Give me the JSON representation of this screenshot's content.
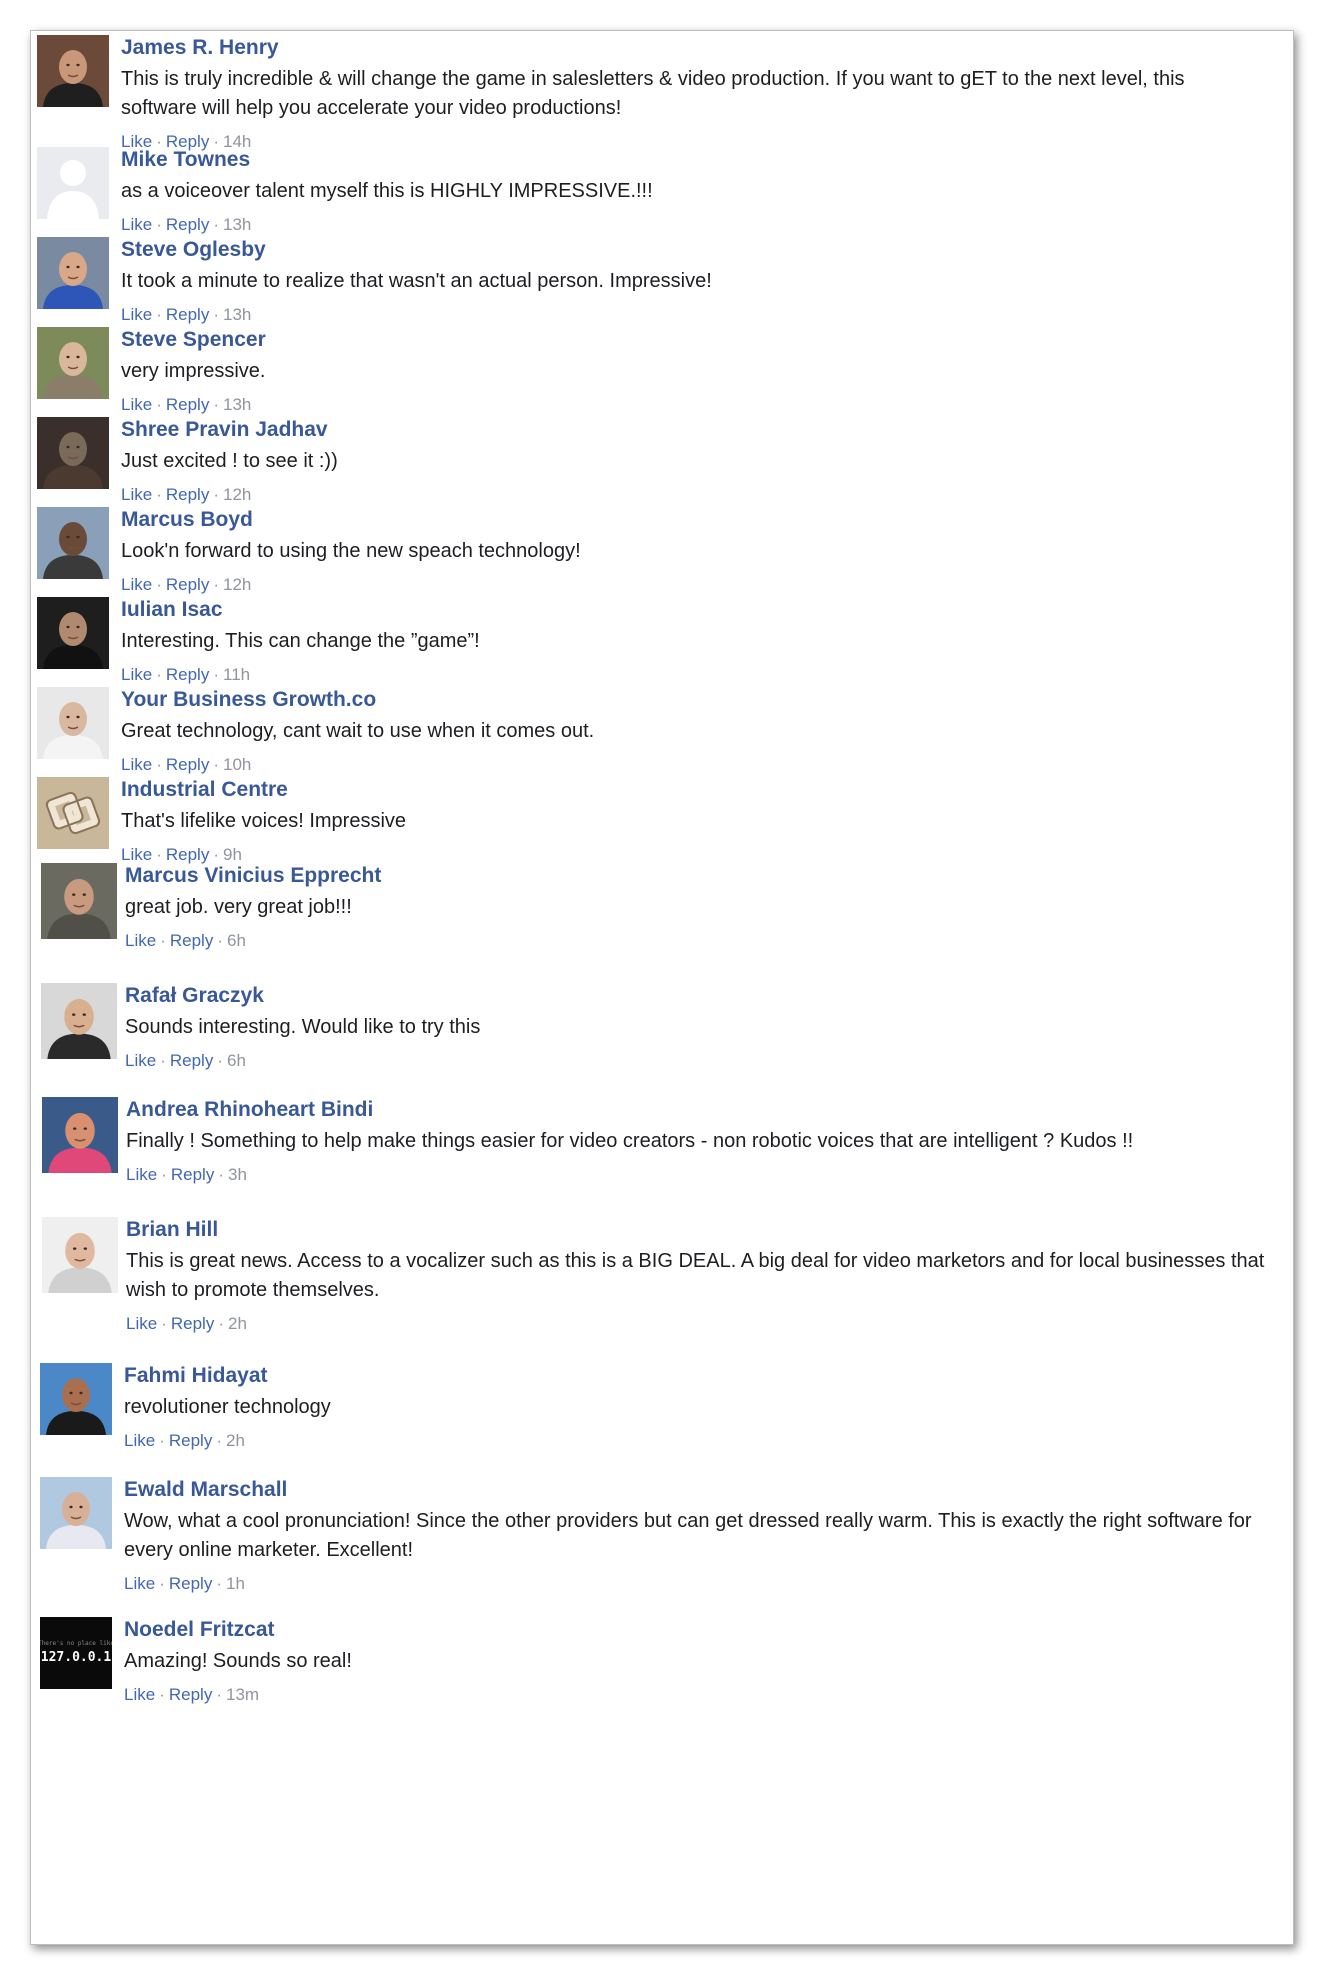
{
  "comments": [
    {
      "author": "James R. Henry",
      "text": "This is truly incredible & will change the game in salesletters & video production. If you want to gET to the next level, this software will help you accelerate your video productions!",
      "like": "Like",
      "reply": "Reply",
      "time": "14h",
      "avatar": {
        "icon": "portrait-man-dark-jacket",
        "bg": "#6b4a3a",
        "face": "#c89878",
        "shirt": "#1f1f1f"
      }
    },
    {
      "author": "Mike Townes",
      "text": "as a voiceover talent myself this is HIGHLY IMPRESSIVE.!!!",
      "like": "Like",
      "reply": "Reply",
      "time": "13h",
      "avatar": {
        "icon": "default-silhouette",
        "bg": "#e9ebee",
        "face": "#ffffff",
        "shirt": "#ffffff"
      }
    },
    {
      "author": "Steve Oglesby",
      "text": "It took a minute to realize that wasn't an actual person. Impressive!",
      "like": "Like",
      "reply": "Reply",
      "time": "13h",
      "avatar": {
        "icon": "portrait-man-blue-shirt",
        "bg": "#7a8aa0",
        "face": "#d8a888",
        "shirt": "#2d56b8"
      }
    },
    {
      "author": "Steve Spencer",
      "text": "very impressive.",
      "like": "Like",
      "reply": "Reply",
      "time": "13h",
      "avatar": {
        "icon": "portrait-man-outdoors",
        "bg": "#7d8a5a",
        "face": "#d9b79a",
        "shirt": "#8a7d6a"
      }
    },
    {
      "author": "Shree Pravin Jadhav",
      "text": "Just excited ! to see it :))",
      "like": "Like",
      "reply": "Reply",
      "time": "12h",
      "avatar": {
        "icon": "portrait-armored-character",
        "bg": "#3a2f2a",
        "face": "#7a6a5a",
        "shirt": "#4a3a30"
      }
    },
    {
      "author": "Marcus Boyd",
      "text": "Look'n forward to using the new speach technology!",
      "like": "Like",
      "reply": "Reply",
      "time": "12h",
      "avatar": {
        "icon": "portrait-man-sea-background",
        "bg": "#8aa0b8",
        "face": "#6a4a38",
        "shirt": "#3a3a3a"
      }
    },
    {
      "author": "Iulian Isac",
      "text": "Interesting. This can change the ”game”!",
      "like": "Like",
      "reply": "Reply",
      "time": "11h",
      "avatar": {
        "icon": "portrait-man-dark-badge",
        "bg": "#1e1e1e",
        "face": "#b08a70",
        "shirt": "#111111"
      }
    },
    {
      "author": "Your Business Growth.co",
      "text": "Great technology, cant wait to use when it comes out.",
      "like": "Like",
      "reply": "Reply",
      "time": "10h",
      "avatar": {
        "icon": "portrait-man-suit-red-tie",
        "bg": "#e8e8e8",
        "face": "#d8b8a0",
        "shirt": "#f4f4f4"
      }
    },
    {
      "author": "Industrial Centre",
      "text": "That's lifelike voices! Impressive",
      "like": "Like",
      "reply": "Reply",
      "time": "9h",
      "avatar": {
        "icon": "logo-knot",
        "bg": "#c9b79a",
        "face": "#efe6d6",
        "shirt": "#8a7458"
      }
    },
    {
      "author": "Marcus Vinicius Epprecht",
      "text": "great job. very great job!!!",
      "like": "Like",
      "reply": "Reply",
      "time": "6h",
      "avatar": {
        "icon": "portrait-man-grey-hair",
        "bg": "#6a6a60",
        "face": "#c89a80",
        "shirt": "#505048"
      }
    },
    {
      "author": "Rafał Graczyk",
      "text": "Sounds interesting. Would like to try this",
      "like": "Like",
      "reply": "Reply",
      "time": "6h",
      "avatar": {
        "icon": "portrait-young-man",
        "bg": "#d8d8d8",
        "face": "#d8b090",
        "shirt": "#2a2a2a"
      }
    },
    {
      "author": "Andrea Rhinoheart Bindi",
      "text": "Finally ! Something to help make things easier for video creators - non robotic voices that are intelligent ? Kudos !!",
      "like": "Like",
      "reply": "Reply",
      "time": "3h",
      "avatar": {
        "icon": "portrait-man-pink-shirt",
        "bg": "#3a5a8a",
        "face": "#d89070",
        "shirt": "#e0487a"
      }
    },
    {
      "author": "Brian Hill",
      "text": "This is great news. Access to a vocalizer such as this is a BIG DEAL. A big deal for video marketors and for local businesses that wish to promote themselves.",
      "like": "Like",
      "reply": "Reply",
      "time": "2h",
      "avatar": {
        "icon": "portrait-man-glasses",
        "bg": "#efefef",
        "face": "#e0b8a0",
        "shirt": "#d0d0d0"
      }
    },
    {
      "author": "Fahmi Hidayat",
      "text": "revolutioner technology",
      "like": "Like",
      "reply": "Reply",
      "time": "2h",
      "avatar": {
        "icon": "portrait-man-beach",
        "bg": "#4a88c8",
        "face": "#a87050",
        "shirt": "#1a1a1a"
      }
    },
    {
      "author": "Ewald Marschall",
      "text": "Wow, what a cool pronunciation! Since the other providers but can get dressed really warm. This is exactly the right software for every online marketer. Excellent!",
      "like": "Like",
      "reply": "Reply",
      "time": "1h",
      "avatar": {
        "icon": "portrait-man-bald",
        "bg": "#b0c8e0",
        "face": "#d8b098",
        "shirt": "#e8e8f0"
      }
    },
    {
      "author": "Noedel Fritzcat",
      "text": "Amazing! Sounds so real!",
      "like": "Like",
      "reply": "Reply",
      "time": "13m",
      "avatar": {
        "icon": "text-avatar-localhost",
        "label": "127.0.0.1",
        "sublabel": "There's no place like",
        "bg": "#0a0a0a",
        "face": "#ffffff",
        "shirt": "#0a0a0a"
      }
    }
  ]
}
